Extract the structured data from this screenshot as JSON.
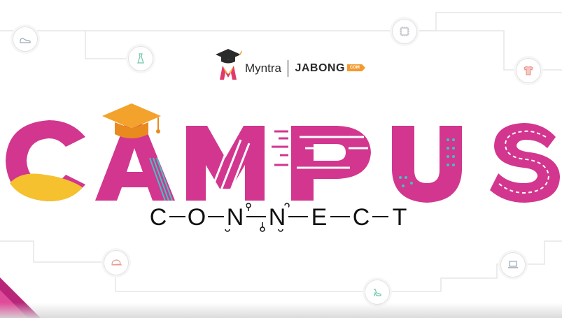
{
  "brand": {
    "myntra": "Myntra",
    "jabong": "JABONG",
    "jabong_tag": "COM"
  },
  "headline": {
    "word1": "CAMPUS",
    "word2": "CONNECT",
    "word1_letters": [
      "C",
      "A",
      "M",
      "P",
      "U",
      "S"
    ],
    "word2_letters": [
      "C",
      "O",
      "N",
      "N",
      "E",
      "C",
      "T"
    ]
  },
  "icons": [
    "shoe-icon",
    "dress-icon",
    "chip-icon",
    "tshirt-icon",
    "cap-icon",
    "laptop-icon",
    "heel-icon",
    "graduation-cap-icon"
  ],
  "colors": {
    "magenta": "#d2368f",
    "yellow": "#f5c12e",
    "teal": "#3dc4c4",
    "cap_orange": "#f3a22b",
    "circuit_line": "#e4e4e4"
  }
}
